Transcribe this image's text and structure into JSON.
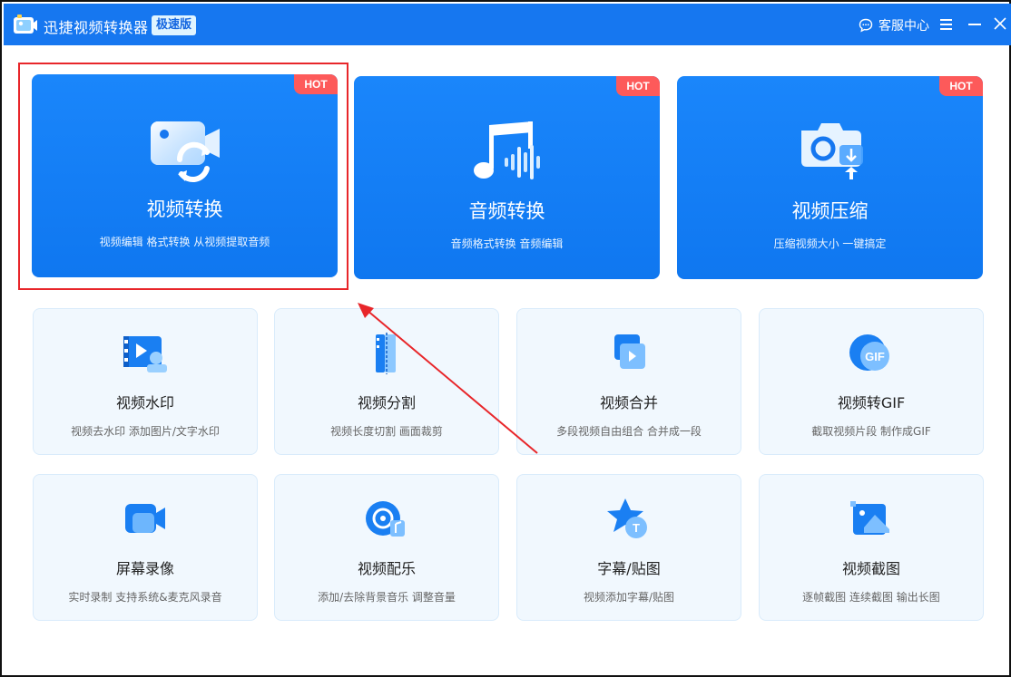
{
  "titlebar": {
    "app_title": "迅捷视频转换器",
    "edition_badge": "极速版",
    "support_label": "客服中心"
  },
  "hot_cards": [
    {
      "tag": "HOT",
      "title": "视频转换",
      "desc": "视频编辑 格式转换 从视频提取音频",
      "icon": "video-convert-icon"
    },
    {
      "tag": "HOT",
      "title": "音频转换",
      "desc": "音频格式转换 音频编辑",
      "icon": "audio-convert-icon"
    },
    {
      "tag": "HOT",
      "title": "视频压缩",
      "desc": "压缩视频大小 一键搞定",
      "icon": "video-compress-icon"
    }
  ],
  "tools": [
    {
      "title": "视频水印",
      "desc": "视频去水印 添加图片/文字水印",
      "icon": "video-watermark-icon"
    },
    {
      "title": "视频分割",
      "desc": "视频长度切割 画面裁剪",
      "icon": "video-split-icon"
    },
    {
      "title": "视频合并",
      "desc": "多段视频自由组合 合并成一段",
      "icon": "video-merge-icon"
    },
    {
      "title": "视频转GIF",
      "desc": "截取视频片段 制作成GIF",
      "icon": "gif-icon",
      "icon_text": "GIF"
    },
    {
      "title": "屏幕录像",
      "desc": "实时录制 支持系统&麦克风录音",
      "icon": "screen-record-icon"
    },
    {
      "title": "视频配乐",
      "desc": "添加/去除背景音乐 调整音量",
      "icon": "music-icon"
    },
    {
      "title": "字幕/贴图",
      "desc": "视频添加字幕/贴图",
      "icon": "subtitle-sticker-icon",
      "icon_text": "T"
    },
    {
      "title": "视频截图",
      "desc": "逐帧截图 连续截图 输出长图",
      "icon": "screenshot-icon"
    }
  ],
  "colors": {
    "titlebar": "#1677f0",
    "hot_card": "#0f77f0",
    "hot_tag": "#fd5a5a",
    "highlight": "#e8262a"
  }
}
